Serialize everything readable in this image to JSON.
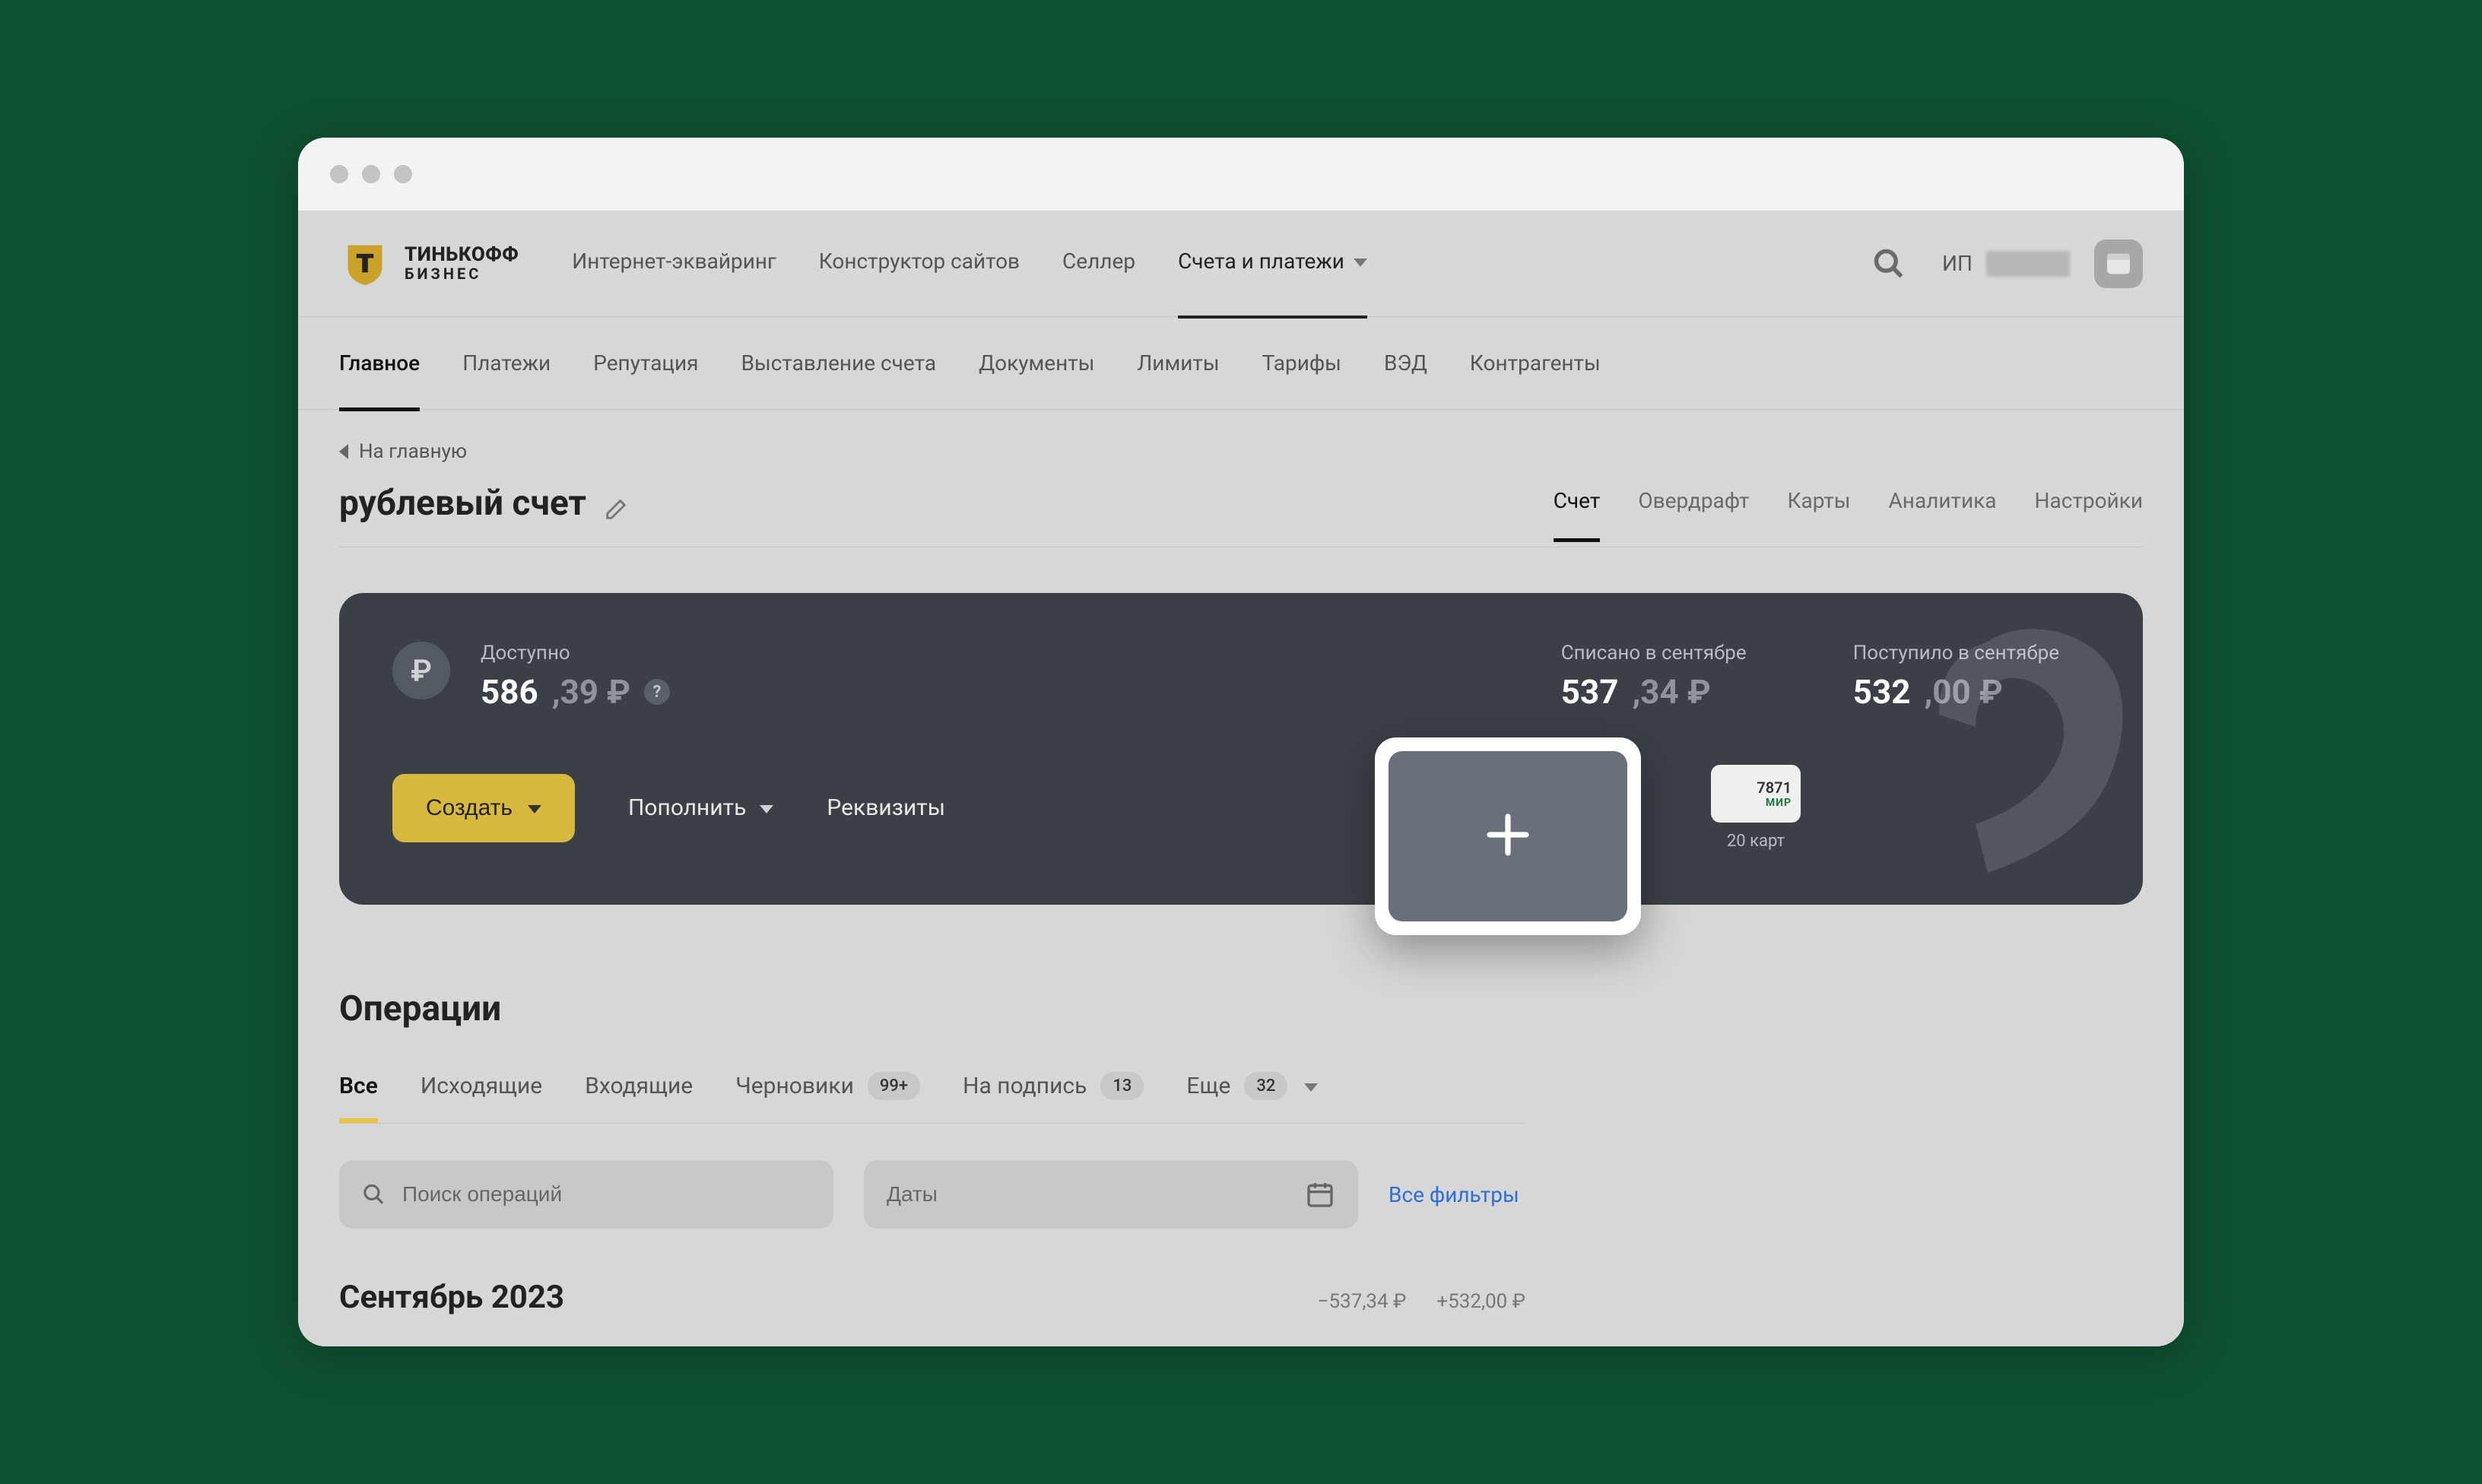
{
  "brand": {
    "line1": "ТИНЬКОФФ",
    "line2": "БИЗНЕС"
  },
  "topnav": {
    "items": [
      {
        "label": "Интернет-эквайринг",
        "active": false
      },
      {
        "label": "Конструктор сайтов",
        "active": false
      },
      {
        "label": "Селлер",
        "active": false
      },
      {
        "label": "Счета и платежи",
        "active": true,
        "dropdown": true
      }
    ],
    "user_prefix": "ИП"
  },
  "subnav": {
    "items": [
      {
        "label": "Главное",
        "active": true
      },
      {
        "label": "Платежи"
      },
      {
        "label": "Репутация"
      },
      {
        "label": "Выставление счета"
      },
      {
        "label": "Документы"
      },
      {
        "label": "Лимиты"
      },
      {
        "label": "Тарифы"
      },
      {
        "label": "ВЭД"
      },
      {
        "label": "Контрагенты"
      }
    ]
  },
  "breadcrumb": {
    "label": "На главную"
  },
  "page": {
    "title": "рублевый счет"
  },
  "section_tabs": [
    {
      "label": "Счет",
      "active": true
    },
    {
      "label": "Овердрафт"
    },
    {
      "label": "Карты"
    },
    {
      "label": "Аналитика"
    },
    {
      "label": "Настройки"
    }
  ],
  "balance": {
    "available_label": "Доступно",
    "available_int": "586",
    "available_frac": ",39 ₽",
    "spent_label": "Списано в сентябре",
    "spent_int": "537",
    "spent_frac": ",34 ₽",
    "received_label": "Поступило в сентябре",
    "received_int": "532",
    "received_frac": ",00 ₽",
    "create_label": "Создать",
    "topup_label": "Пополнить",
    "details_label": "Реквизиты",
    "card_last4": "7871",
    "card_system": "МИР",
    "cards_count": "20 карт"
  },
  "operations": {
    "title": "Операции",
    "tabs": [
      {
        "label": "Все",
        "active": true
      },
      {
        "label": "Исходящие"
      },
      {
        "label": "Входящие"
      },
      {
        "label": "Черновики",
        "badge": "99+"
      },
      {
        "label": "На подпись",
        "badge": "13"
      },
      {
        "label": "Еще",
        "badge": "32",
        "dropdown": true
      }
    ],
    "search_placeholder": "Поиск операций",
    "dates_placeholder": "Даты",
    "all_filters": "Все фильтры",
    "month_title": "Сентябрь 2023",
    "month_out": "−537,34 ₽",
    "month_in": "+532,00 ₽"
  }
}
